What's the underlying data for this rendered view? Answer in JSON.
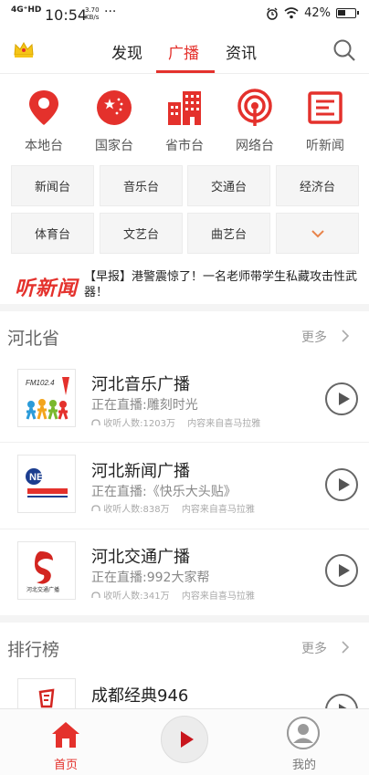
{
  "status": {
    "signal": "4G⁺HD",
    "time": "10:54",
    "speed_value": "3.70",
    "speed_unit": "KB/s",
    "more": "···",
    "battery": "42%"
  },
  "topnav": {
    "tabs": [
      {
        "label": "发现"
      },
      {
        "label": "广播",
        "active": true
      },
      {
        "label": "资讯"
      }
    ]
  },
  "categories": [
    {
      "label": "本地台",
      "icon": "location-pin-icon"
    },
    {
      "label": "国家台",
      "icon": "national-star-icon"
    },
    {
      "label": "省市台",
      "icon": "building-icon"
    },
    {
      "label": "网络台",
      "icon": "broadcast-icon"
    },
    {
      "label": "听新闻",
      "icon": "news-icon"
    }
  ],
  "grid": {
    "row1": [
      "新闻台",
      "音乐台",
      "交通台",
      "经济台"
    ],
    "row2": [
      "体育台",
      "文艺台",
      "曲艺台"
    ]
  },
  "news": {
    "logo_text": "听新闻",
    "headline": "【早报】港警震惊了！一名老师带学生私藏攻击性武器！"
  },
  "section_province": {
    "title": "河北省",
    "more": "更多",
    "items": [
      {
        "name": "河北音乐广播",
        "live": "正在直播:雕刻时光",
        "listeners": "收听人数:1203万",
        "source": "内容来自喜马拉雅",
        "logo_text": "FM102.4"
      },
      {
        "name": "河北新闻广播",
        "live": "正在直播:《快乐大头贴》",
        "listeners": "收听人数:838万",
        "source": "内容来自喜马拉雅",
        "logo_text": "NEWS"
      },
      {
        "name": "河北交通广播",
        "live": "正在直播:992大家帮",
        "listeners": "收听人数:341万",
        "source": "内容来自喜马拉雅",
        "logo_text": "河北交通广播"
      }
    ]
  },
  "section_rank": {
    "title": "排行榜",
    "more": "更多",
    "items": [
      {
        "name": "成都经典946"
      }
    ]
  },
  "bottom": {
    "home": "首页",
    "me": "我的",
    "accent": "#e4312c"
  }
}
